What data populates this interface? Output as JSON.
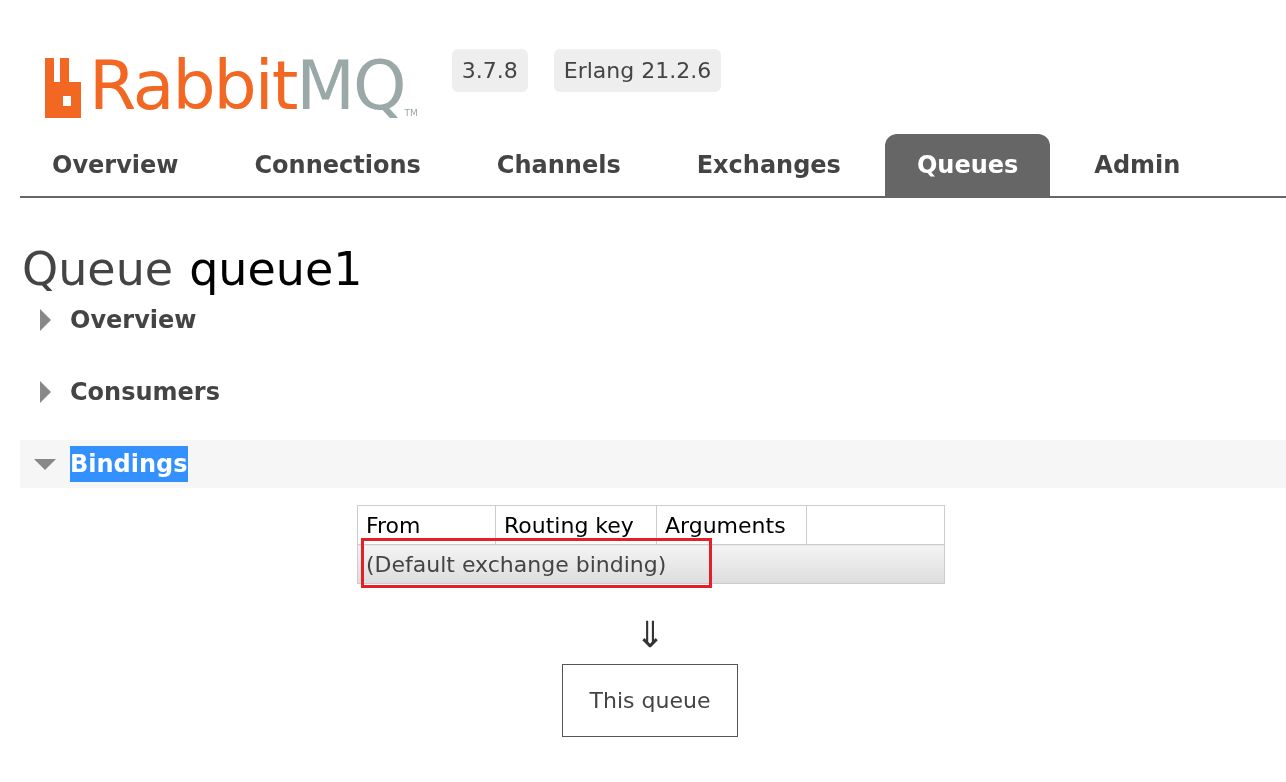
{
  "logo": {
    "brand": "Rabbit",
    "product": "MQ",
    "mark": "TM"
  },
  "badges": [
    "3.7.8",
    "Erlang 21.2.6"
  ],
  "tabs": [
    {
      "label": "Overview",
      "selected": false
    },
    {
      "label": "Connections",
      "selected": false
    },
    {
      "label": "Channels",
      "selected": false
    },
    {
      "label": "Exchanges",
      "selected": false
    },
    {
      "label": "Queues",
      "selected": true
    },
    {
      "label": "Admin",
      "selected": false
    }
  ],
  "heading": {
    "prefix": "Queue",
    "name": "queue1"
  },
  "sections": [
    {
      "title": "Overview",
      "expanded": false,
      "text_selected": false
    },
    {
      "title": "Consumers",
      "expanded": false,
      "text_selected": false
    },
    {
      "title": "Bindings",
      "expanded": true,
      "text_selected": true
    }
  ],
  "bindings": {
    "columns": [
      "From",
      "Routing key",
      "Arguments"
    ],
    "rows": [
      {
        "label": "(Default exchange binding)",
        "annotated": true
      }
    ],
    "arrow": "⇓",
    "target": "This queue"
  }
}
